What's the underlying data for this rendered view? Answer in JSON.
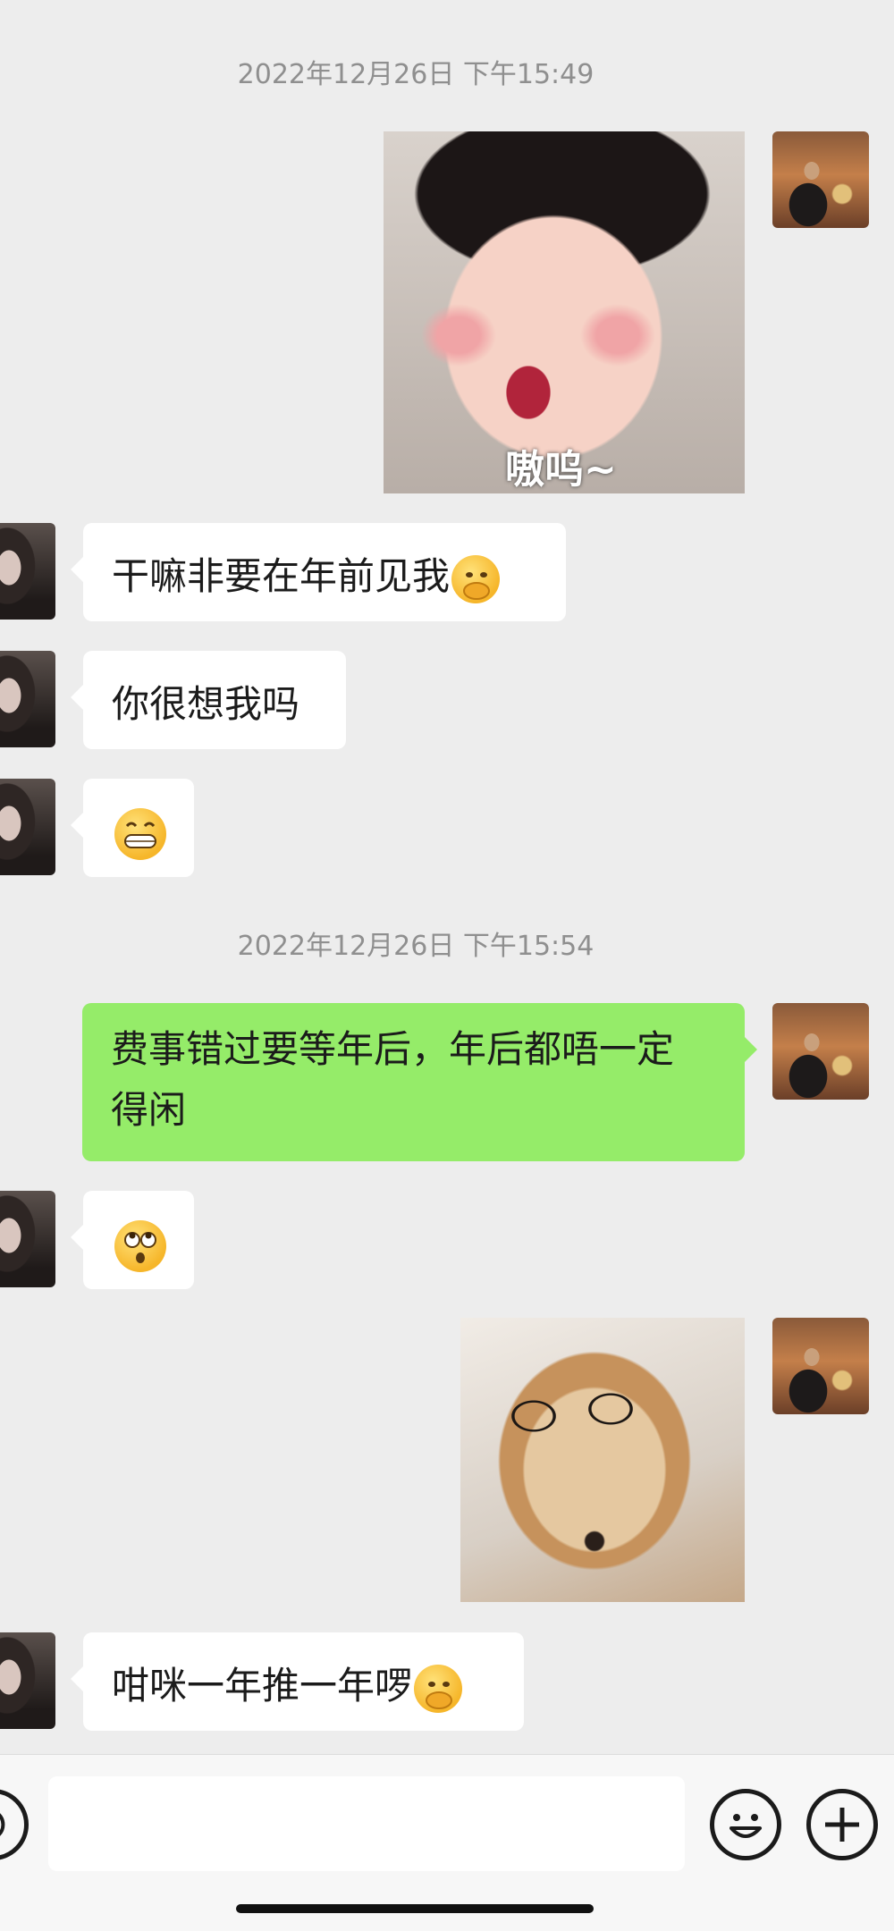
{
  "timestamps": [
    "2022年12月26日 下午15:49",
    "2022年12月26日 下午15:54"
  ],
  "messages": {
    "m1_sticker_caption": "嗷呜~",
    "m2_text": "干嘛非要在年前见我",
    "m3_text": "你很想我吗",
    "m5_text_line1": "费事错过要等年后，年后都唔一定",
    "m5_text_line2": "得闲",
    "m8_text": "咁咪一年推一年啰"
  },
  "icons": {
    "emoji_hand_over_mouth": "hand-over-mouth-icon",
    "emoji_grin": "grinning-face-icon",
    "emoji_eye_roll": "rolling-eyes-icon",
    "voice": "voice-icon",
    "emoji_picker": "smile-icon",
    "more": "plus-icon"
  },
  "colors": {
    "background": "#ededed",
    "incoming_bubble": "#ffffff",
    "outgoing_bubble": "#95ec69",
    "timestamp_text": "#8f8f8f"
  },
  "input": {
    "value": ""
  }
}
